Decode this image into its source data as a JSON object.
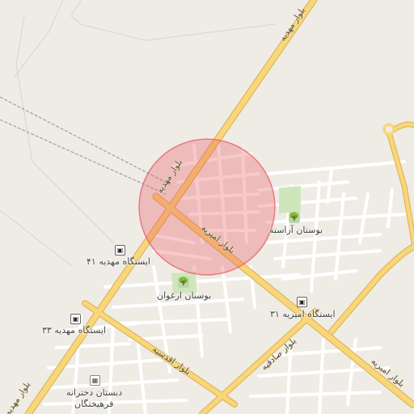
{
  "labels": {
    "road_mahdieh_top": "بلوار مهدیه",
    "road_mahdieh_mid": "بلوار مهدیه",
    "road_mahdieh_bottom": "بلوار مهدیه",
    "road_amirieh_mid": "بلوار امیریه",
    "road_amirieh_bottom": "بلوار امیریه",
    "road_aghdasieh": "بلوار اقدسیه",
    "road_sadeghieh": "بلوار صادقیه",
    "park_arasteh": "بوستان آراسته",
    "park_arghavan": "بوستان ارغوان",
    "stop_mahdieh_41": "ایستگاه مهدیه ۴۱",
    "stop_mahdieh_33": "ایستگاه مهدیه ۳۳",
    "stop_amirieh_31": "ایستگاه امیریه ۳۱",
    "school_line1": "دبستان دخترانه",
    "school_line2": "فرهیختگان"
  },
  "icons": {
    "bus": "bus-stop-icon",
    "park": "tree-icon",
    "school": "school-icon"
  },
  "colors": {
    "background": "#efece6",
    "major_road": "#f8d77a",
    "major_road_casing": "#e2b65a",
    "minor_road": "#ffffff",
    "park": "#cfe6bd",
    "highlight_circle": "#e8545e",
    "railway": "#9aa0aa"
  }
}
